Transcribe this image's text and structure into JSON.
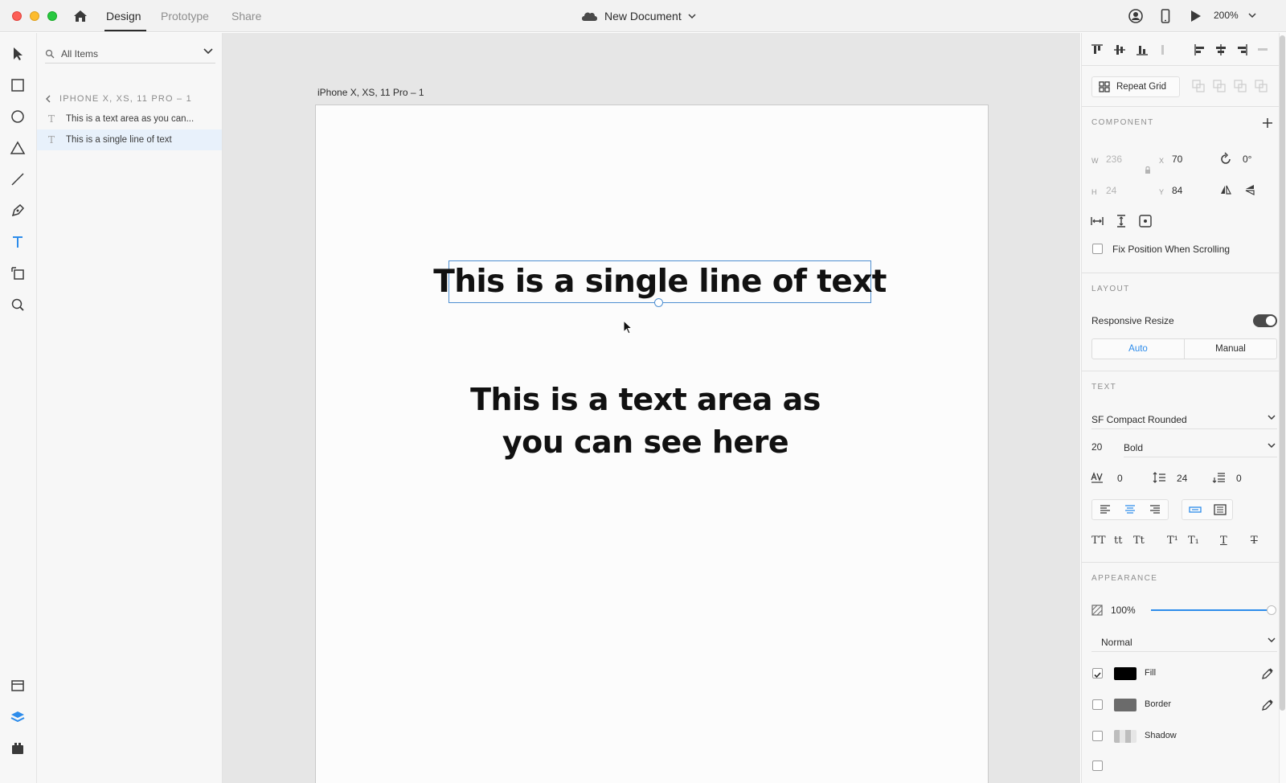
{
  "titlebar": {
    "tabs": [
      "Design",
      "Prototype",
      "Share"
    ],
    "document_title": "New Document",
    "zoom": "200%"
  },
  "layers": {
    "filter_label": "All Items",
    "artboard_name": "IPHONE X, XS, 11 PRO – 1",
    "items": [
      {
        "label": "This is a text area as you can...",
        "icon": "text-layer-icon"
      },
      {
        "label": "This is a single line of text",
        "icon": "text-layer-icon"
      }
    ]
  },
  "canvas": {
    "artboard_label": "iPhone X, XS, 11 Pro – 1",
    "single_line_text": "This is a single line of text",
    "area_text": "This is a text area as you can see here"
  },
  "inspector": {
    "repeat_grid_label": "Repeat Grid",
    "component_title": "COMPONENT",
    "w_label": "W",
    "w_value": "236",
    "h_label": "H",
    "h_value": "24",
    "x_label": "X",
    "x_value": "70",
    "y_label": "Y",
    "y_value": "84",
    "rotation_value": "0°",
    "fix_position_label": "Fix Position When Scrolling",
    "layout_title": "LAYOUT",
    "responsive_resize_label": "Responsive Resize",
    "resize_modes": [
      "Auto",
      "Manual"
    ],
    "text_title": "TEXT",
    "font_family": "SF Compact Rounded",
    "font_size": "20",
    "font_weight": "Bold",
    "char_spacing": "0",
    "line_spacing": "24",
    "paragraph_spacing": "0",
    "appearance_title": "APPEARANCE",
    "opacity": "100%",
    "opacity_fraction": 1.0,
    "blend_mode": "Normal",
    "fill_label": "Fill",
    "border_label": "Border",
    "shadow_label": "Shadow"
  },
  "colors": {
    "accent": "#2d8ceb",
    "selection": "#4f8fd1",
    "fill_swatch": "#000000",
    "border_swatch": "#6b6b6b"
  }
}
